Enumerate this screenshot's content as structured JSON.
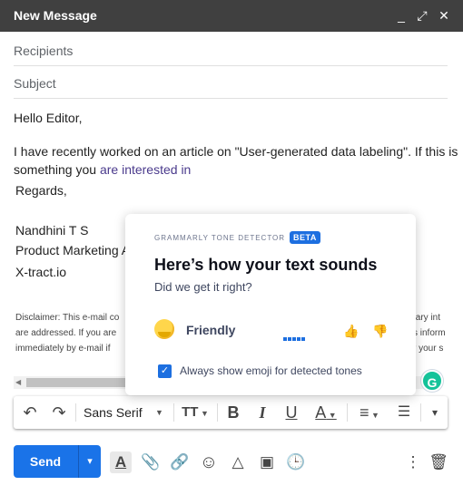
{
  "window": {
    "title": "New Message",
    "controls": {
      "minimize": "_",
      "expand": "⤢",
      "close": "✕"
    }
  },
  "fields": {
    "recipients_placeholder": "Recipients",
    "subject_placeholder": "Subject"
  },
  "body": {
    "greeting": "Hello Editor,",
    "line1": "I have recently worked on an article on \"User-generated data labeling\". If this is",
    "line2_prefix": "something you ",
    "line2_highlight": "are interested in",
    "regards": "Regards,",
    "sig_name": "Nandhini T S",
    "sig_title": "Product Marketing A",
    "sig_company": "X-tract.io"
  },
  "disclaimer": {
    "line1_left": "Disclaimer: This e-mail co",
    "line1_right": "tary int",
    "line2_left": "are addressed. If you are",
    "line2_right": "s inform",
    "line3_left": "immediately by e-mail if",
    "line3_right": "r your s"
  },
  "grammarly": {
    "badge": "G",
    "card": {
      "header": "GRAMMARLY TONE DETECTOR",
      "beta": "BETA",
      "title": "Here’s how your text sounds",
      "subtitle": "Did we get it right?",
      "tone": "Friendly",
      "intensity": 5,
      "checkbox_label": "Always show emoji for detected tones",
      "checkbox_checked": true
    }
  },
  "toolbar": {
    "undo": "↶",
    "redo": "↷",
    "font": "Sans Serif",
    "font_size": "TT",
    "bold": "B",
    "italic": "I",
    "underline": "U",
    "text_color": "A",
    "align": "≡",
    "list": "☰",
    "more": "▾"
  },
  "bottom": {
    "send_label": "Send",
    "send_more": "▾",
    "formatting": "A",
    "attach": "📎",
    "link": "🔗",
    "emoji": "☺",
    "drive": "△",
    "photo": "▣",
    "schedule": "🕒",
    "options": "⋮",
    "delete": "🗑"
  },
  "colors": {
    "titlebar": "#404040",
    "send": "#1a73e8",
    "grammarly_green": "#15c39a",
    "grammarly_blue": "#1d6fe0"
  }
}
